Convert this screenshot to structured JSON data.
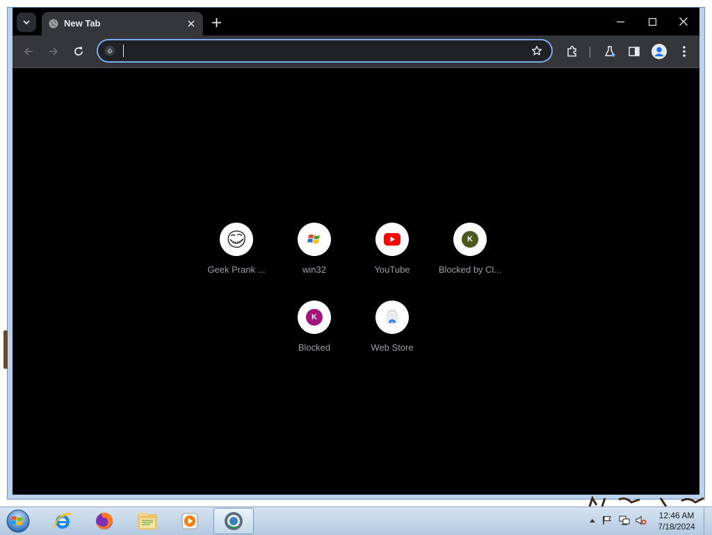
{
  "browser": {
    "tab": {
      "title": "New Tab"
    },
    "omnibox": {
      "value": "",
      "placeholder": ""
    },
    "accent": "#7cacf8",
    "icons": [
      "tab-search-icon",
      "close-icon",
      "plus-icon",
      "minimize-icon",
      "maximize-icon",
      "window-close-icon",
      "back-arrow-icon",
      "forward-arrow-icon",
      "reload-icon",
      "star-icon",
      "extensions-icon",
      "labs-icon",
      "side-panel-icon",
      "profile-icon",
      "more-vert-icon"
    ]
  },
  "shortcuts": [
    {
      "label": "Geek Prank ...",
      "icon": "trollface-icon"
    },
    {
      "label": "win32",
      "icon": "windows-logo-icon"
    },
    {
      "label": "YouTube",
      "icon": "youtube-icon",
      "color": "#ff0000"
    },
    {
      "label": "Blocked by Cl...",
      "icon": "letter-badge-icon",
      "letter": "K",
      "color": "#4a5a1f"
    },
    {
      "label": "Blocked",
      "icon": "letter-badge-icon",
      "letter": "K",
      "color": "#a3157a"
    },
    {
      "label": "Web Store",
      "icon": "web-store-icon"
    }
  ],
  "taskbar": {
    "apps": [
      "internet-explorer-icon",
      "firefox-icon",
      "file-explorer-icon",
      "media-player-icon",
      "chrome-icon"
    ],
    "clock": {
      "time": "12:46 AM",
      "date": "7/18/2024"
    }
  }
}
